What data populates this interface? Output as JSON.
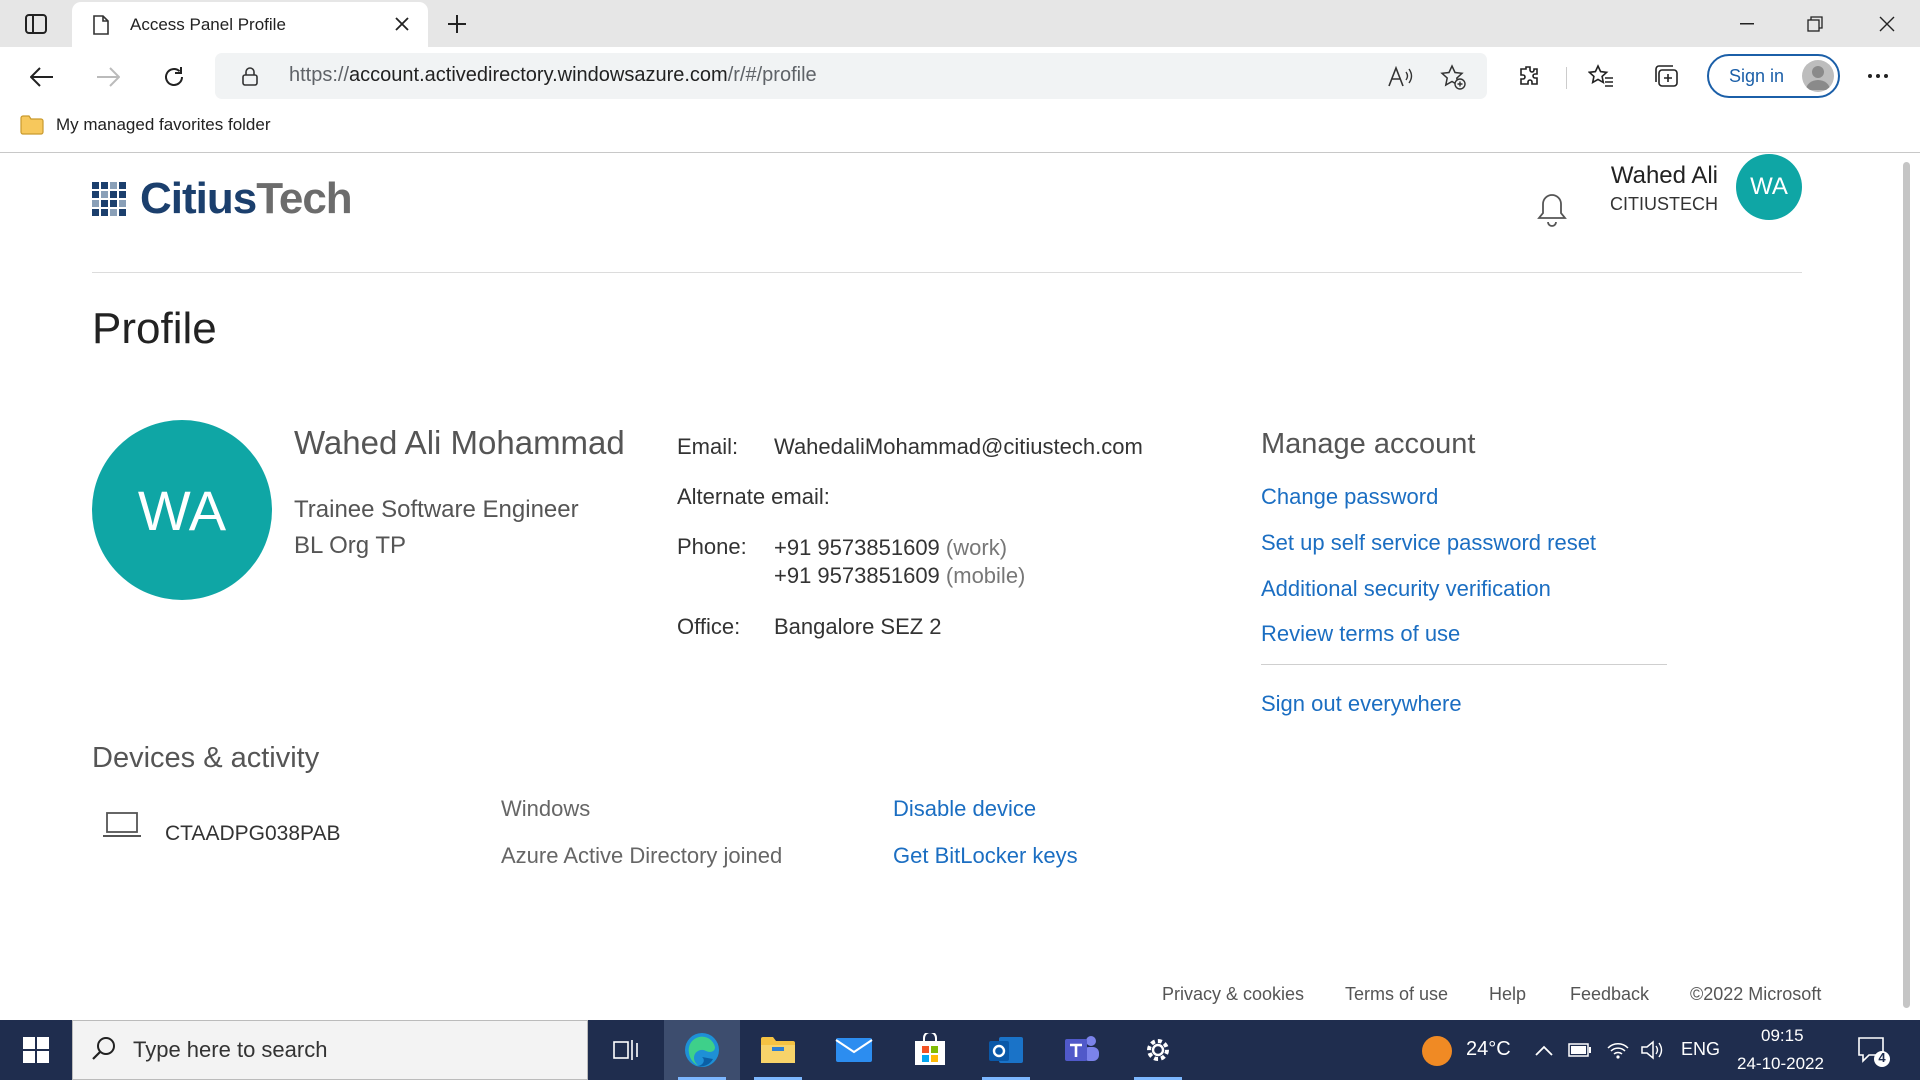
{
  "browser": {
    "tab_title": "Access Panel Profile",
    "url_prefix": "https://",
    "url_host": "account.activedirectory.windowsazure.com",
    "url_path": "/r/#/profile",
    "signin_label": "Sign in",
    "favorites_folder": "My managed favorites folder"
  },
  "header": {
    "logo_part1": "Citius",
    "logo_part2": "Tech",
    "user_name": "Wahed Ali",
    "user_org": "CITIUSTECH",
    "avatar_initials": "WA"
  },
  "profile": {
    "page_title": "Profile",
    "avatar_initials": "WA",
    "full_name": "Wahed Ali Mohammad",
    "job_title": "Trainee Software Engineer",
    "department": "BL Org TP",
    "email_label": "Email:",
    "email_value": "WahedaliMohammad@citiustech.com",
    "alt_email_label": "Alternate email:",
    "phone_label": "Phone:",
    "phone_work": "+91 9573851609",
    "phone_work_type": "(work)",
    "phone_mobile": "+91 9573851609",
    "phone_mobile_type": "(mobile)",
    "office_label": "Office:",
    "office_value": "Bangalore SEZ 2"
  },
  "manage": {
    "heading": "Manage account",
    "links": [
      "Change password",
      "Set up self service password reset",
      "Additional security verification",
      "Review terms of use"
    ],
    "sign_out": "Sign out everywhere"
  },
  "devices": {
    "heading": "Devices & activity",
    "device_name": "CTAADPG038PAB",
    "os": "Windows",
    "join_type": "Azure Active Directory joined",
    "disable_link": "Disable device",
    "bitlocker_link": "Get BitLocker keys"
  },
  "footer": {
    "privacy": "Privacy & cookies",
    "terms": "Terms of use",
    "help": "Help",
    "feedback": "Feedback",
    "copyright": "©2022 Microsoft"
  },
  "taskbar": {
    "search_placeholder": "Type here to search",
    "temperature": "24°C",
    "language": "ENG",
    "time": "09:15",
    "date": "24-10-2022",
    "notification_count": "4"
  },
  "colors": {
    "accent_teal": "#0fa6a5",
    "link_blue": "#1b6ec2",
    "taskbar_bg": "#1f2d4e"
  }
}
